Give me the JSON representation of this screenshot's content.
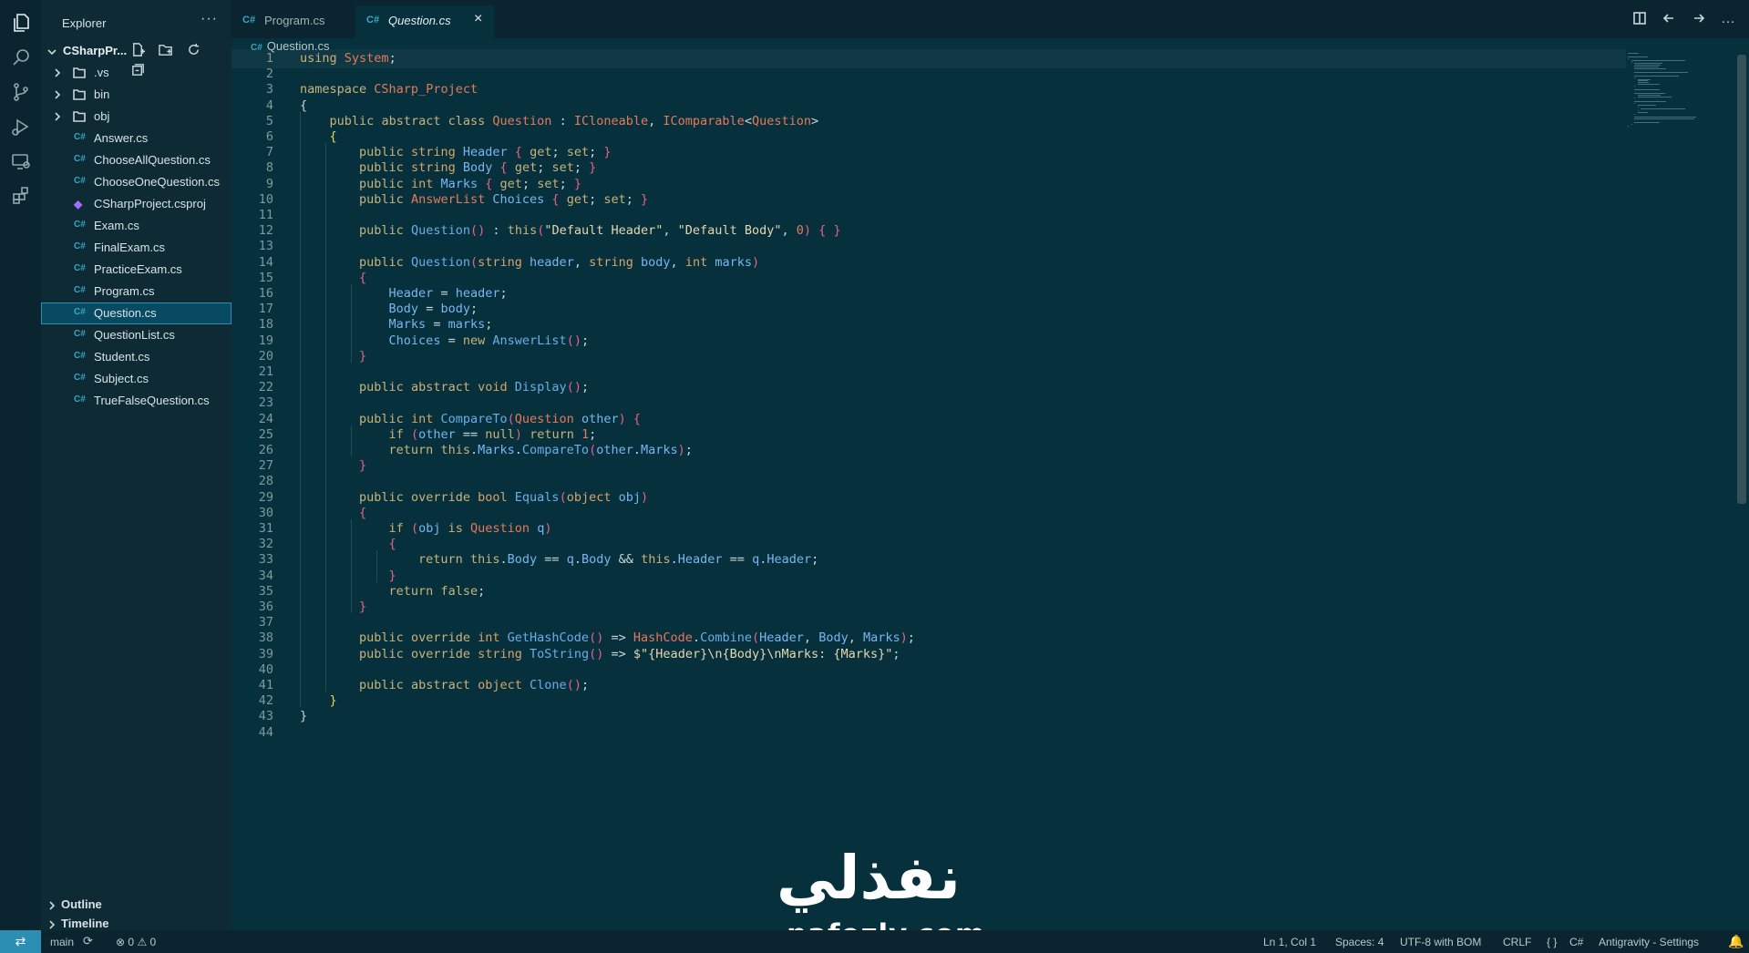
{
  "activity_bar": {
    "icons": [
      "explorer-icon",
      "search-icon",
      "source-control-icon",
      "run-debug-icon",
      "remote-explorer-icon",
      "extensions-icon"
    ]
  },
  "explorer": {
    "title": "Explorer",
    "more": "···",
    "project": "CSharpPr...",
    "items": [
      {
        "label": ".vs",
        "kind": "folder"
      },
      {
        "label": "bin",
        "kind": "folder"
      },
      {
        "label": "obj",
        "kind": "folder"
      },
      {
        "label": "Answer.cs",
        "kind": "cs"
      },
      {
        "label": "ChooseAllQuestion.cs",
        "kind": "cs"
      },
      {
        "label": "ChooseOneQuestion.cs",
        "kind": "cs"
      },
      {
        "label": "CSharpProject.csproj",
        "kind": "csproj"
      },
      {
        "label": "Exam.cs",
        "kind": "cs"
      },
      {
        "label": "FinalExam.cs",
        "kind": "cs"
      },
      {
        "label": "PracticeExam.cs",
        "kind": "cs"
      },
      {
        "label": "Program.cs",
        "kind": "cs"
      },
      {
        "label": "Question.cs",
        "kind": "cs",
        "selected": true
      },
      {
        "label": "QuestionList.cs",
        "kind": "cs"
      },
      {
        "label": "Student.cs",
        "kind": "cs"
      },
      {
        "label": "Subject.cs",
        "kind": "cs"
      },
      {
        "label": "TrueFalseQuestion.cs",
        "kind": "cs"
      }
    ],
    "outline": "Outline",
    "timeline": "Timeline"
  },
  "tabs": [
    {
      "icon": "C#",
      "label": "Program.cs",
      "active": false
    },
    {
      "icon": "C#",
      "label": "Question.cs",
      "active": true,
      "close": "×"
    }
  ],
  "breadcrumb": {
    "icon": "C#",
    "file": "Question.cs"
  },
  "code_lines": [
    "using System;",
    "",
    "namespace CSharp_Project",
    "{",
    "    public abstract class Question : ICloneable, IComparable<Question>",
    "    {",
    "        public string Header { get; set; }",
    "        public string Body { get; set; }",
    "        public int Marks { get; set; }",
    "        public AnswerList Choices { get; set; }",
    "",
    "        public Question() : this(\"Default Header\", \"Default Body\", 0) { }",
    "",
    "        public Question(string header, string body, int marks)",
    "        {",
    "            Header = header;",
    "            Body = body;",
    "            Marks = marks;",
    "            Choices = new AnswerList();",
    "        }",
    "",
    "        public abstract void Display();",
    "",
    "        public int CompareTo(Question other) {",
    "            if (other == null) return 1;",
    "            return this.Marks.CompareTo(other.Marks);",
    "        }",
    "",
    "        public override bool Equals(object obj)",
    "        {",
    "            if (obj is Question q)",
    "            {",
    "                return this.Body == q.Body && this.Header == q.Header;",
    "            }",
    "            return false;",
    "        }",
    "",
    "        public override int GetHashCode() => HashCode.Combine(Header, Body, Marks);",
    "        public override string ToString() => $\"{Header}\\n{Body}\\nMarks: {Marks}\";",
    "",
    "        public abstract object Clone();",
    "    }",
    "}",
    ""
  ],
  "watermark": {
    "arabic": "نفذلي",
    "latin": "nafezly.com"
  },
  "status": {
    "branch": "main",
    "errors": "0",
    "warnings": "0",
    "position": "Ln 1, Col 1",
    "spaces": "Spaces: 4",
    "encoding": "UTF-8 with BOM",
    "eol": "CRLF",
    "language": "C#",
    "language_braces": "{ }",
    "extension": "Antigravity - Settings"
  }
}
